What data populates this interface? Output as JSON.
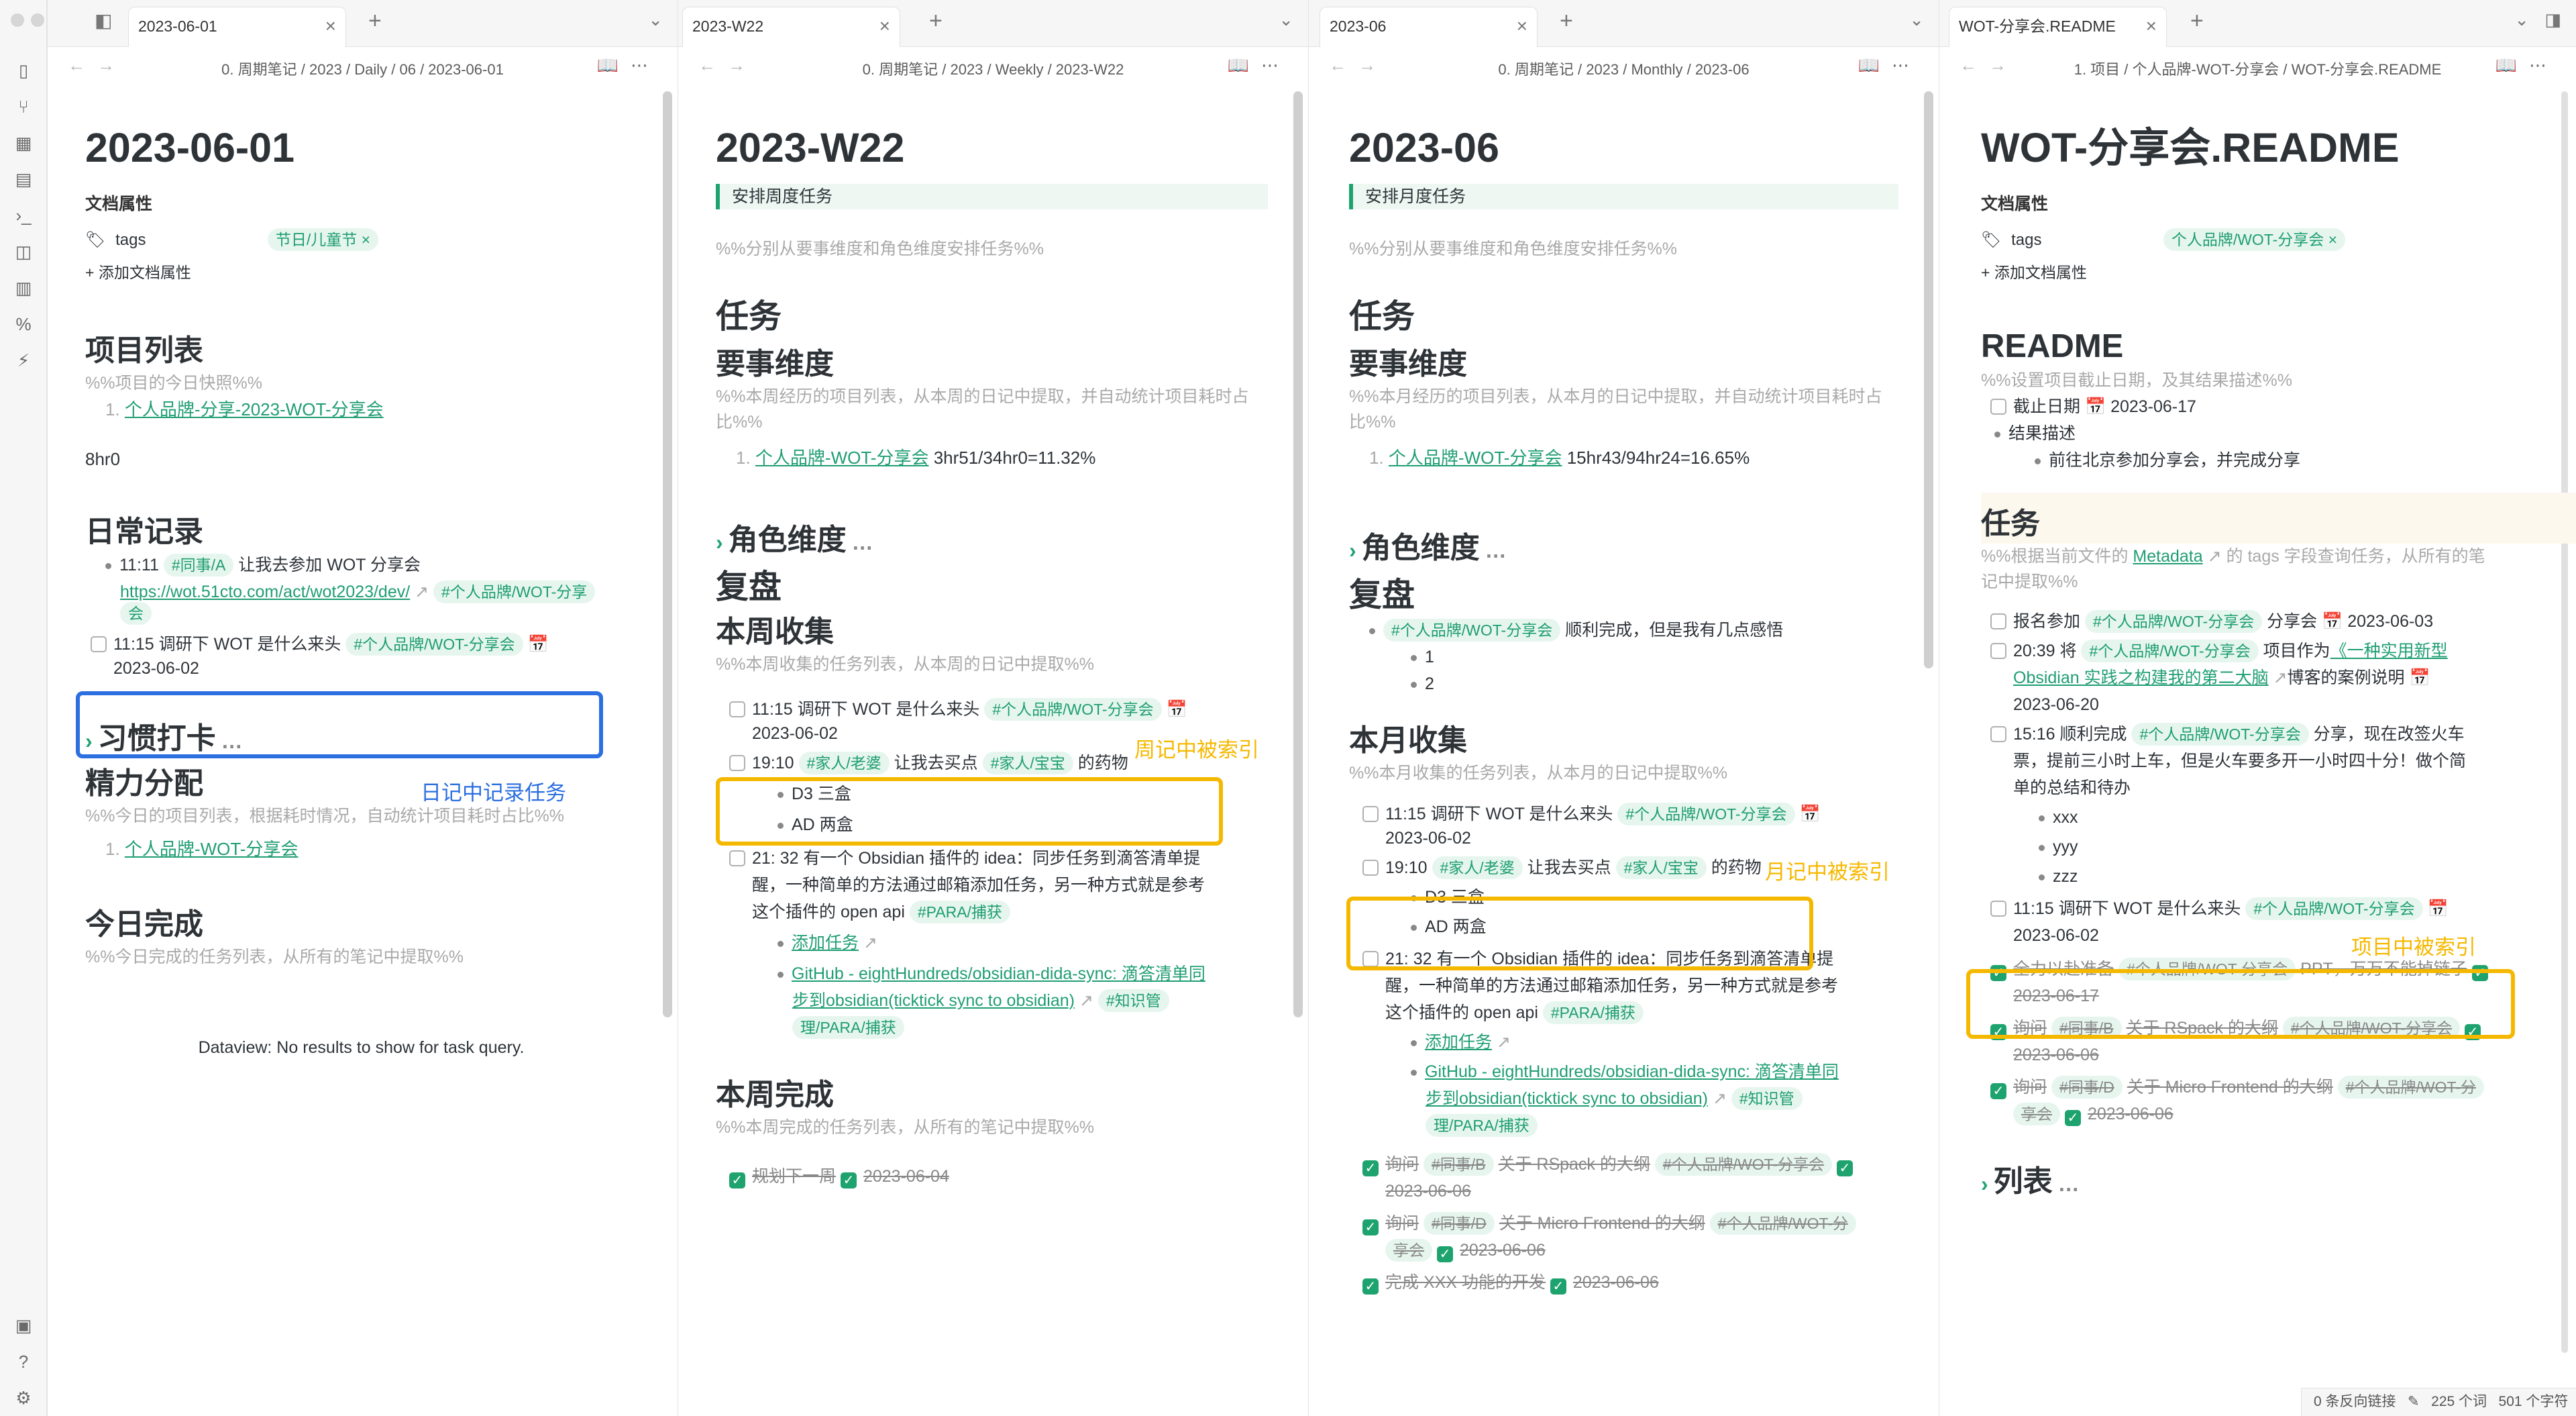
{
  "panes": {
    "daily": {
      "tab_title": "2023-06-01",
      "breadcrumb": "0. 周期笔记  /  2023  /  Daily  /  06  /  2023-06-01",
      "title": "2023-06-01",
      "props_label": "文档属性",
      "tags_label": "tags",
      "tag_value": "节日/儿童节 ×",
      "add_prop": "+  添加文档属性",
      "h_projects": "项目列表",
      "c_projects": "%%项目的今日快照%%",
      "project_item": "个人品牌-分享-2023-WOT-分享会",
      "hours": "8hr0",
      "h_daily": "日常记录",
      "log1_time": "11:11",
      "log1_tag": "#同事/A",
      "log1_text": "让我去参加 WOT 分享会",
      "log1_link": "https://wot.51cto.com/act/wot2023/dev/",
      "log1_tag2": "#个人品牌/WOT-分享",
      "log1_tag2b": "会",
      "task_text": "11:15 调研下 WOT 是什么来头",
      "task_tag": "#个人品牌/WOT-分享会",
      "task_date": "2023-06-02",
      "annot": "日记中记录任务",
      "h_habit": "习惯打卡",
      "h_energy": "精力分配",
      "c_energy": "%%今日的项目列表，根据耗时情况，自动统计项目耗时占比%%",
      "energy_item": "个人品牌-WOT-分享会",
      "h_done": "今日完成",
      "c_done": "%%今日完成的任务列表，从所有的笔记中提取%%",
      "dataview": "Dataview: No results to show for task query."
    },
    "weekly": {
      "tab_title": "2023-W22",
      "breadcrumb": "0. 周期笔记  /  2023  /  Weekly  /  2023-W22",
      "title": "2023-W22",
      "callout": "安排周度任务",
      "c_arrange": "%%分别从要事维度和角色维度安排任务%%",
      "h_tasks": "任务",
      "h_key": "要事维度",
      "c_key": "%%本周经历的项目列表，从本周的日记中提取，并自动统计项目耗时占比%%",
      "key_item": "个人品牌-WOT-分享会",
      "key_val": "3hr51/34hr0=11.32%",
      "h_role": "角色维度",
      "h_review": "复盘",
      "h_collect": "本周收集",
      "c_collect": "%%本周收集的任务列表，从本周的日记中提取%%",
      "annot": "周记中被索引",
      "t1_text": "11:15 调研下 WOT 是什么来头",
      "t1_tag": "#个人品牌/WOT-分享会",
      "t1_date": "2023-06-02",
      "t2_time": "19:10",
      "t2_tag1": "#家人/老婆",
      "t2_text": "让我去买点",
      "t2_tag2": "#家人/宝宝",
      "t2_text2": "的药物",
      "t2_sub1": "D3 三盒",
      "t2_sub2": "AD 两盒",
      "t3_l1": "21: 32 有一个 Obsidian 插件的 idea：同步任务到滴答清单提",
      "t3_l2": "醒，一种简单的方法通过邮箱添加任务，另一种方式就是参考",
      "t3_l3": "这个插件的 open api",
      "t3_tag": "#PARA/捕获",
      "t3_link1": "添加任务",
      "t3_link2": "GitHub - eightHundreds/obsidian-dida-sync: 滴答清单同",
      "t3_link2b": "步到obsidian(ticktick sync to obsidian)",
      "t3_tag2": "#知识管",
      "t3_tag2b": "理/PARA/捕获",
      "h_wdone": "本周完成",
      "c_wdone": "%%本周完成的任务列表，从所有的笔记中提取%%",
      "done1": "规划下一周",
      "done1_date": "2023-06-04"
    },
    "monthly": {
      "tab_title": "2023-06",
      "breadcrumb": "0. 周期笔记  /  2023  /  Monthly  /  2023-06",
      "title": "2023-06",
      "callout": "安排月度任务",
      "c_arrange": "%%分别从要事维度和角色维度安排任务%%",
      "h_tasks": "任务",
      "h_key": "要事维度",
      "c_key": "%%本月经历的项目列表，从本月的日记中提取，并自动统计项目耗时占比%%",
      "key_item": "个人品牌-WOT-分享会",
      "key_val": "15hr43/94hr24=16.65%",
      "h_role": "角色维度",
      "h_review": "复盘",
      "r_tag": "#个人品牌/WOT-分享会",
      "r_text": "顺利完成，但是我有几点感悟",
      "r_1": "1",
      "r_2": "2",
      "h_collect": "本月收集",
      "c_collect": "%%本月收集的任务列表，从本月的日记中提取%%",
      "annot": "月记中被索引",
      "t1_text": "11:15 调研下 WOT 是什么来头",
      "t1_tag": "#个人品牌/WOT-分享会",
      "t1_date": "2023-06-02",
      "t2_time": "19:10",
      "t2_tag1": "#家人/老婆",
      "t2_text": "让我去买点",
      "t2_tag2": "#家人/宝宝",
      "t2_text2": "的药物",
      "t2_sub1": "D3 三盒",
      "t2_sub2": "AD 两盒",
      "t3_l1": "21: 32 有一个 Obsidian 插件的 idea：同步任务到滴答清单提",
      "t3_l2": "醒，一种简单的方法通过邮箱添加任务，另一种方式就是参考",
      "t3_l3": "这个插件的 open api",
      "t3_tag": "#PARA/捕获",
      "t3_link1": "添加任务",
      "t3_link2": "GitHub - eightHundreds/obsidian-dida-sync: 滴答清单同",
      "t3_link2b": "步到obsidian(ticktick sync to obsidian)",
      "t3_tag2": "#知识管",
      "t3_tag2b": "理/PARA/捕获",
      "d1_a": "询问",
      "d1_tag": "#同事/B",
      "d1_b": "关于 RSpack 的大纲",
      "d1_tag2": "#个人品牌/WOT-分享会",
      "d1_date": "2023-06-06",
      "d2_a": "询问",
      "d2_tag": "#同事/D",
      "d2_b": "关于 Micro Frontend 的大纲",
      "d2_tag2": "#个人品牌/WOT-分",
      "d2_tag2b": "享会",
      "d2_date": "2023-06-06",
      "d3": "完成 XXX 功能的开发",
      "d3_date": "2023-06-06"
    },
    "readme": {
      "tab_title": "WOT-分享会.README",
      "breadcrumb": "1. 项目  /  个人品牌-WOT-分享会  /  WOT-分享会.README",
      "title": "WOT-分享会.README",
      "props_label": "文档属性",
      "tags_label": "tags",
      "tag_value": "个人品牌/WOT-分享会 ×",
      "add_prop": "+  添加文档属性",
      "h_readme": "README",
      "c_readme": "%%设置项目截止日期，及其结果描述%%",
      "deadline": "截止日期",
      "deadline_date": "2023-06-17",
      "result": "结果描述",
      "result_sub": "前往北京参加分享会，并完成分享",
      "h_tasks": "任务",
      "c_tasks_a": "%%根据当前文件的",
      "c_tasks_link": "Metadata",
      "c_tasks_b": "的 tags 字段查询任务，从所有的笔",
      "c_tasks_c": "记中提取%%",
      "r1_a": "报名参加",
      "r1_tag": "#个人品牌/WOT-分享会",
      "r1_b": "分享会",
      "r1_date": "2023-06-03",
      "r2_a": "20:39 将",
      "r2_tag": "#个人品牌/WOT-分享会",
      "r2_b": "项目作为",
      "r2_link": "《一种实用新型",
      "r2_link2": "Obsidian 实践之构建我的第二大脑",
      "r2_c": "博客的案例说明",
      "r2_date": "2023-06-20",
      "r3_a": "15:16 顺利完成",
      "r3_tag": "#个人品牌/WOT-分享会",
      "r3_b": "分享，现在改签火车",
      "r3_l2": "票，提前三小时上车，但是火车要多开一小时四十分！做个简",
      "r3_l3": "单的总结和待办",
      "r3_s1": "xxx",
      "r3_s2": "yyy",
      "r3_s3": "zzz",
      "annot": "项目中被索引",
      "r4_text": "11:15 调研下 WOT 是什么来头",
      "r4_tag": "#个人品牌/WOT-分享会",
      "r4_date": "2023-06-02",
      "d1_a": "全力以赴准备",
      "d1_tag": "#个人品牌/WOT-分享会",
      "d1_b": "PPT，万万不能掉链子",
      "d1_date": "2023-06-17",
      "d2_a": "询问",
      "d2_tag": "#同事/B",
      "d2_b": "关于 RSpack 的大纲",
      "d2_tag2": "#个人品牌/WOT-分享会",
      "d2_date": "2023-06-06",
      "d3_a": "询问",
      "d3_tag": "#同事/D",
      "d3_b": "关于 Micro Frontend 的大纲",
      "d3_tag2": "#个人品牌/WOT-分",
      "d3_tag2b": "享会",
      "d3_date": "2023-06-06",
      "h_list": "列表"
    }
  },
  "status_bar": {
    "backlinks": "0 条反向链接",
    "words": "225 个词",
    "chars": "501 个字符"
  },
  "colors": {
    "accent": "#1ea36f",
    "highlight": "#f5b800",
    "blue_highlight": "#2b6fe0"
  }
}
